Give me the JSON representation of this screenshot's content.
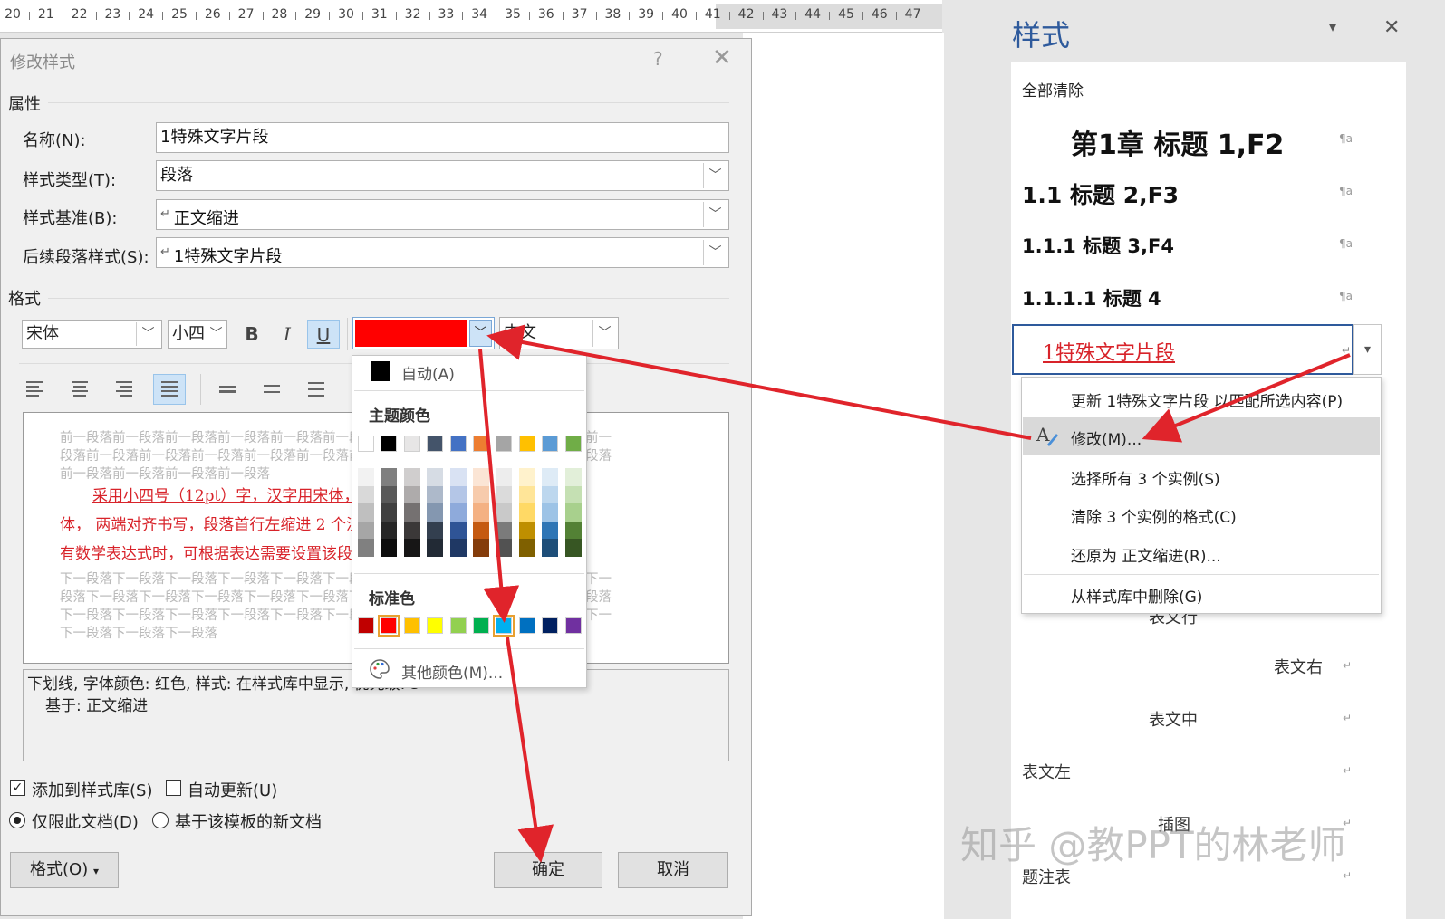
{
  "ruler": {
    "ticks": [
      "20",
      "21",
      "22",
      "23",
      "24",
      "25",
      "26",
      "27",
      "28",
      "29",
      "30",
      "31",
      "32",
      "33",
      "34",
      "35",
      "36",
      "37",
      "38",
      "39",
      "40",
      "41",
      "42",
      "43",
      "44",
      "45",
      "46",
      "47"
    ]
  },
  "dialog": {
    "title": "修改样式",
    "help": "?",
    "close": "✕",
    "section_properties": "属性",
    "name_label": "名称(N):",
    "name_value": "1特殊文字片段",
    "type_label": "样式类型(T):",
    "type_value": "段落",
    "based_label": "样式基准(B):",
    "based_value": "正文缩进",
    "next_label": "后续段落样式(S):",
    "next_value": "1特殊文字片段",
    "section_format": "格式",
    "font": "宋体",
    "size": "小四",
    "bold": "B",
    "italic": "I",
    "underline": "U",
    "script": "中文",
    "preview": {
      "prev_lines": [
        "前一段落前一段落前一段落前一段落前一段落前一段落前一段落前一段落前一段落前一段落前一",
        "段落前一段落前一段落前一段落前一段落前一段落前一段落前一段落前一段落前一段落前一段落",
        "前一段落前一段落前一段落前一段落"
      ],
      "red_lines": [
        "采用小四号（12pt）字，汉字用宋体，英文用 Times New Roman",
        "体， 两端对齐书写，段落首行左缩进 2 个汉字符。行距为 20 磅（段落中",
        "有数学表达式时，可根据表达需要设置该段的行距），段前、段后空 0 磅。"
      ],
      "next_lines": [
        "下一段落下一段落下一段落下一段落下一段落下一段落下一段落下一段落下一段落下一段落下一",
        "段落下一段落下一段落下一段落下一段落下一段落下一段落下一段落下一段落下一段落下一段落",
        "下一段落下一段落下一段落下一段落下一段落下一段落下一段落下一段落下一段落下一段落下一",
        "下一段落下一段落下一段落"
      ]
    },
    "desc_line1": "下划线, 字体颜色: 红色, 样式: 在样式库中显示, 优先级: 3",
    "desc_line2": "基于: 正文缩进",
    "add_to_gallery": "添加到样式库(S)",
    "auto_update": "自动更新(U)",
    "only_this_doc": "仅限此文档(D)",
    "new_docs_template": "基于该模板的新文档",
    "format_button": "格式(O)",
    "ok_button": "确定",
    "cancel_button": "取消"
  },
  "colors": {
    "selected_font_color": "#ff0000",
    "accent": "#2e5a9c",
    "arrow": "#e0242b"
  },
  "color_picker": {
    "auto_label": "自动(A)",
    "theme_label": "主题颜色",
    "theme_top": [
      "#ffffff",
      "#000000",
      "#e7e6e6",
      "#44546a",
      "#4472c4",
      "#ed7d31",
      "#a5a5a5",
      "#ffc000",
      "#5b9bd5",
      "#70ad47"
    ],
    "theme_shades": [
      [
        "#f2f2f2",
        "#d9d9d9",
        "#bfbfbf",
        "#a6a6a6",
        "#808080"
      ],
      [
        "#7f7f7f",
        "#595959",
        "#404040",
        "#262626",
        "#0d0d0d"
      ],
      [
        "#d0cece",
        "#aeabab",
        "#757171",
        "#3b3838",
        "#171616"
      ],
      [
        "#d6dce4",
        "#adb9ca",
        "#8497b0",
        "#333f4f",
        "#222a35"
      ],
      [
        "#d9e2f3",
        "#b4c6e7",
        "#8eaadb",
        "#2f5496",
        "#1f3864"
      ],
      [
        "#fbe5d5",
        "#f7cbac",
        "#f4b183",
        "#c55a11",
        "#843c0b"
      ],
      [
        "#ededed",
        "#dbdbdb",
        "#c9c9c9",
        "#7b7b7b",
        "#525252"
      ],
      [
        "#fff2cc",
        "#ffe598",
        "#ffd965",
        "#bf8f00",
        "#7f6000"
      ],
      [
        "#deebf6",
        "#bdd7ee",
        "#9dc3e6",
        "#2e75b5",
        "#1e4e79"
      ],
      [
        "#e2efd9",
        "#c5e0b3",
        "#a8d08d",
        "#538135",
        "#375623"
      ]
    ],
    "standard_label": "标准色",
    "standard": [
      "#c00000",
      "#ff0000",
      "#ffc000",
      "#ffff00",
      "#92d050",
      "#00b050",
      "#00b0f0",
      "#0070c0",
      "#002060",
      "#7030a0"
    ],
    "more_label": "其他颜色(M)..."
  },
  "styles_pane": {
    "title": "样式",
    "dropdown": "▾",
    "close": "✕",
    "clear_all": "全部清除",
    "h1": "第1章  标题 1,F2",
    "h2": "1.1  标题 2,F3",
    "h3": "1.1.1  标题 3,F4",
    "h4": "1.1.1.1  标题 4",
    "selected_style": "1特殊文字片段",
    "body_row": "表文行",
    "right": "表文右",
    "center": "表文中",
    "left": "表文左",
    "figure": "插图",
    "caption": "题注表",
    "para_mark": "¶a",
    "return_mark": "↵"
  },
  "context_menu": {
    "update": "更新 1特殊文字片段 以匹配所选内容(P)",
    "modify": "修改(M)...",
    "select_all": "选择所有 3 个实例(S)",
    "clear_format": "清除 3 个实例的格式(C)",
    "revert": "还原为 正文缩进(R)...",
    "remove": "从样式库中删除(G)"
  },
  "watermark": "知乎 @教PPT的林老师"
}
